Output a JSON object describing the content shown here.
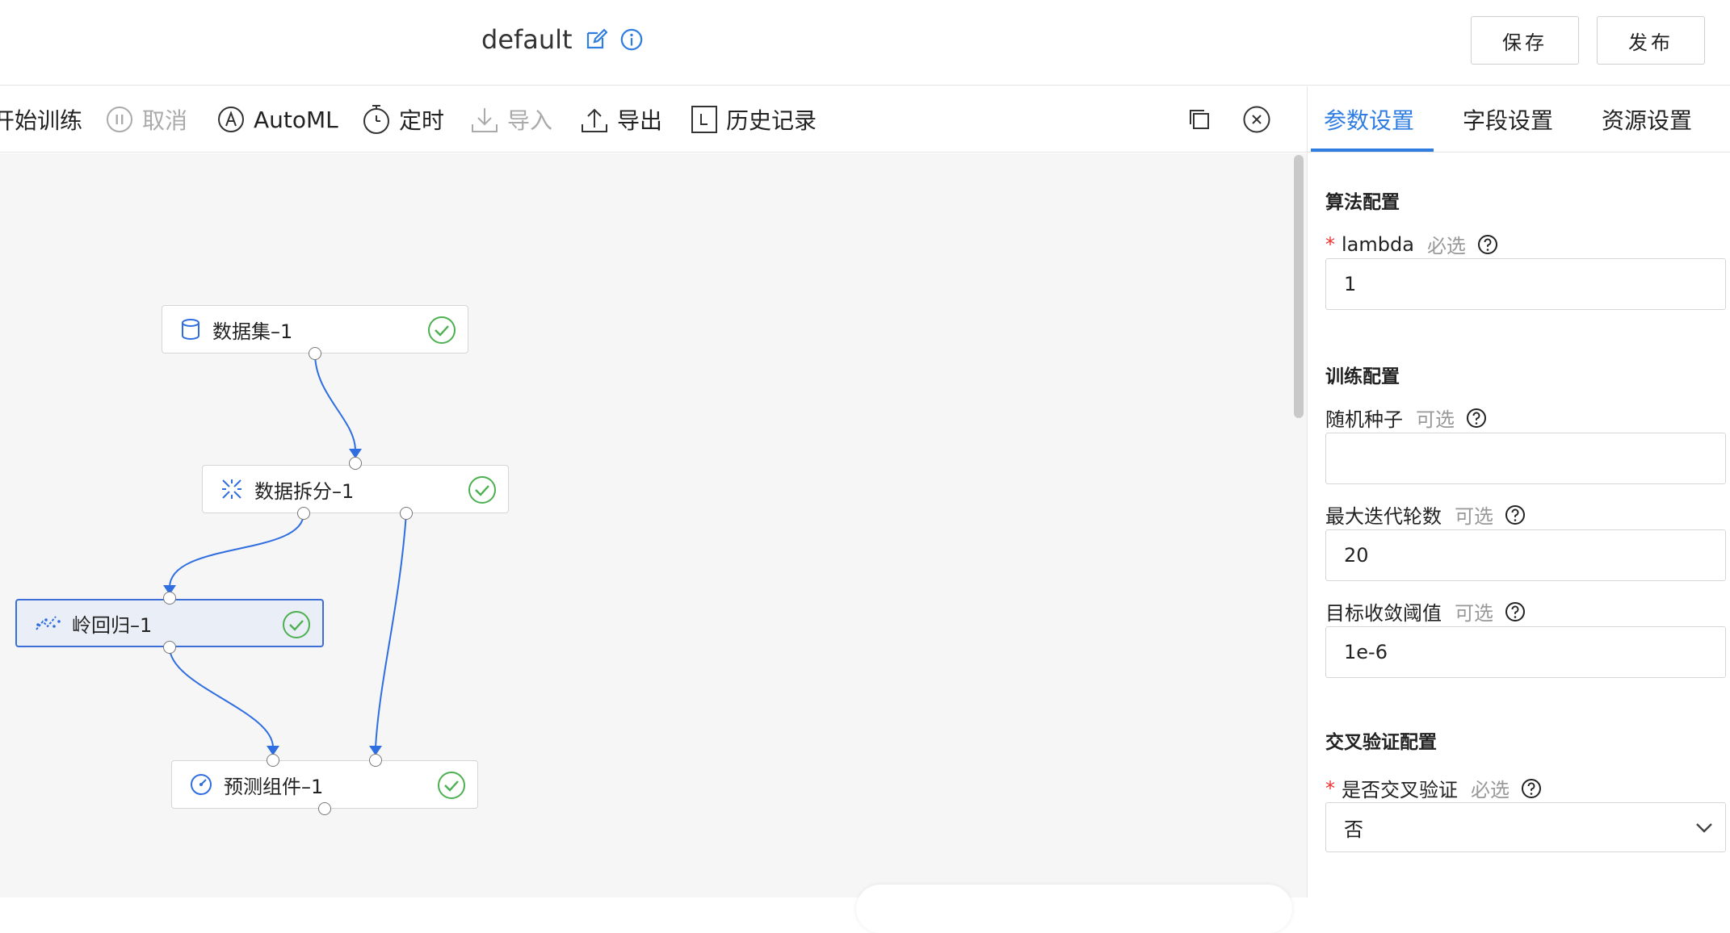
{
  "header": {
    "title": "default",
    "save_label": "保存",
    "publish_label": "发布"
  },
  "toolbar": {
    "start_training": "开始训练",
    "cancel": "取消",
    "automl": "AutoML",
    "schedule": "定时",
    "import": "导入",
    "export": "导出",
    "history": "历史记录"
  },
  "canvas": {
    "nodes": [
      {
        "label": "数据集–1",
        "icon": "database-icon",
        "status": "success"
      },
      {
        "label": "数据拆分–1",
        "icon": "split-icon",
        "status": "success"
      },
      {
        "label": "岭回归–1",
        "icon": "regression-icon",
        "status": "success",
        "selected": true
      },
      {
        "label": "预测组件–1",
        "icon": "gauge-icon",
        "status": "success"
      }
    ],
    "edge_color": "#2f6ee0"
  },
  "panel": {
    "tabs": [
      {
        "label": "参数设置",
        "active": true
      },
      {
        "label": "字段设置",
        "active": false
      },
      {
        "label": "资源设置",
        "active": false
      }
    ],
    "sections": {
      "algorithm": "算法配置",
      "training": "训练配置",
      "cross_validation": "交叉验证配置"
    },
    "fields": {
      "lambda": {
        "label": "lambda",
        "hint": "必选",
        "required": true,
        "value": "1"
      },
      "random_seed": {
        "label": "随机种子",
        "hint": "可选",
        "required": false,
        "value": ""
      },
      "max_iter": {
        "label": "最大迭代轮数",
        "hint": "可选",
        "required": false,
        "value": "20"
      },
      "tolerance": {
        "label": "目标收敛阈值",
        "hint": "可选",
        "required": false,
        "value": "1e-6"
      },
      "cross_validate": {
        "label": "是否交叉验证",
        "hint": "必选",
        "required": true,
        "value": "否"
      }
    }
  },
  "colors": {
    "accent": "#2f7de1",
    "success": "#4caf50",
    "required": "#e33333"
  }
}
